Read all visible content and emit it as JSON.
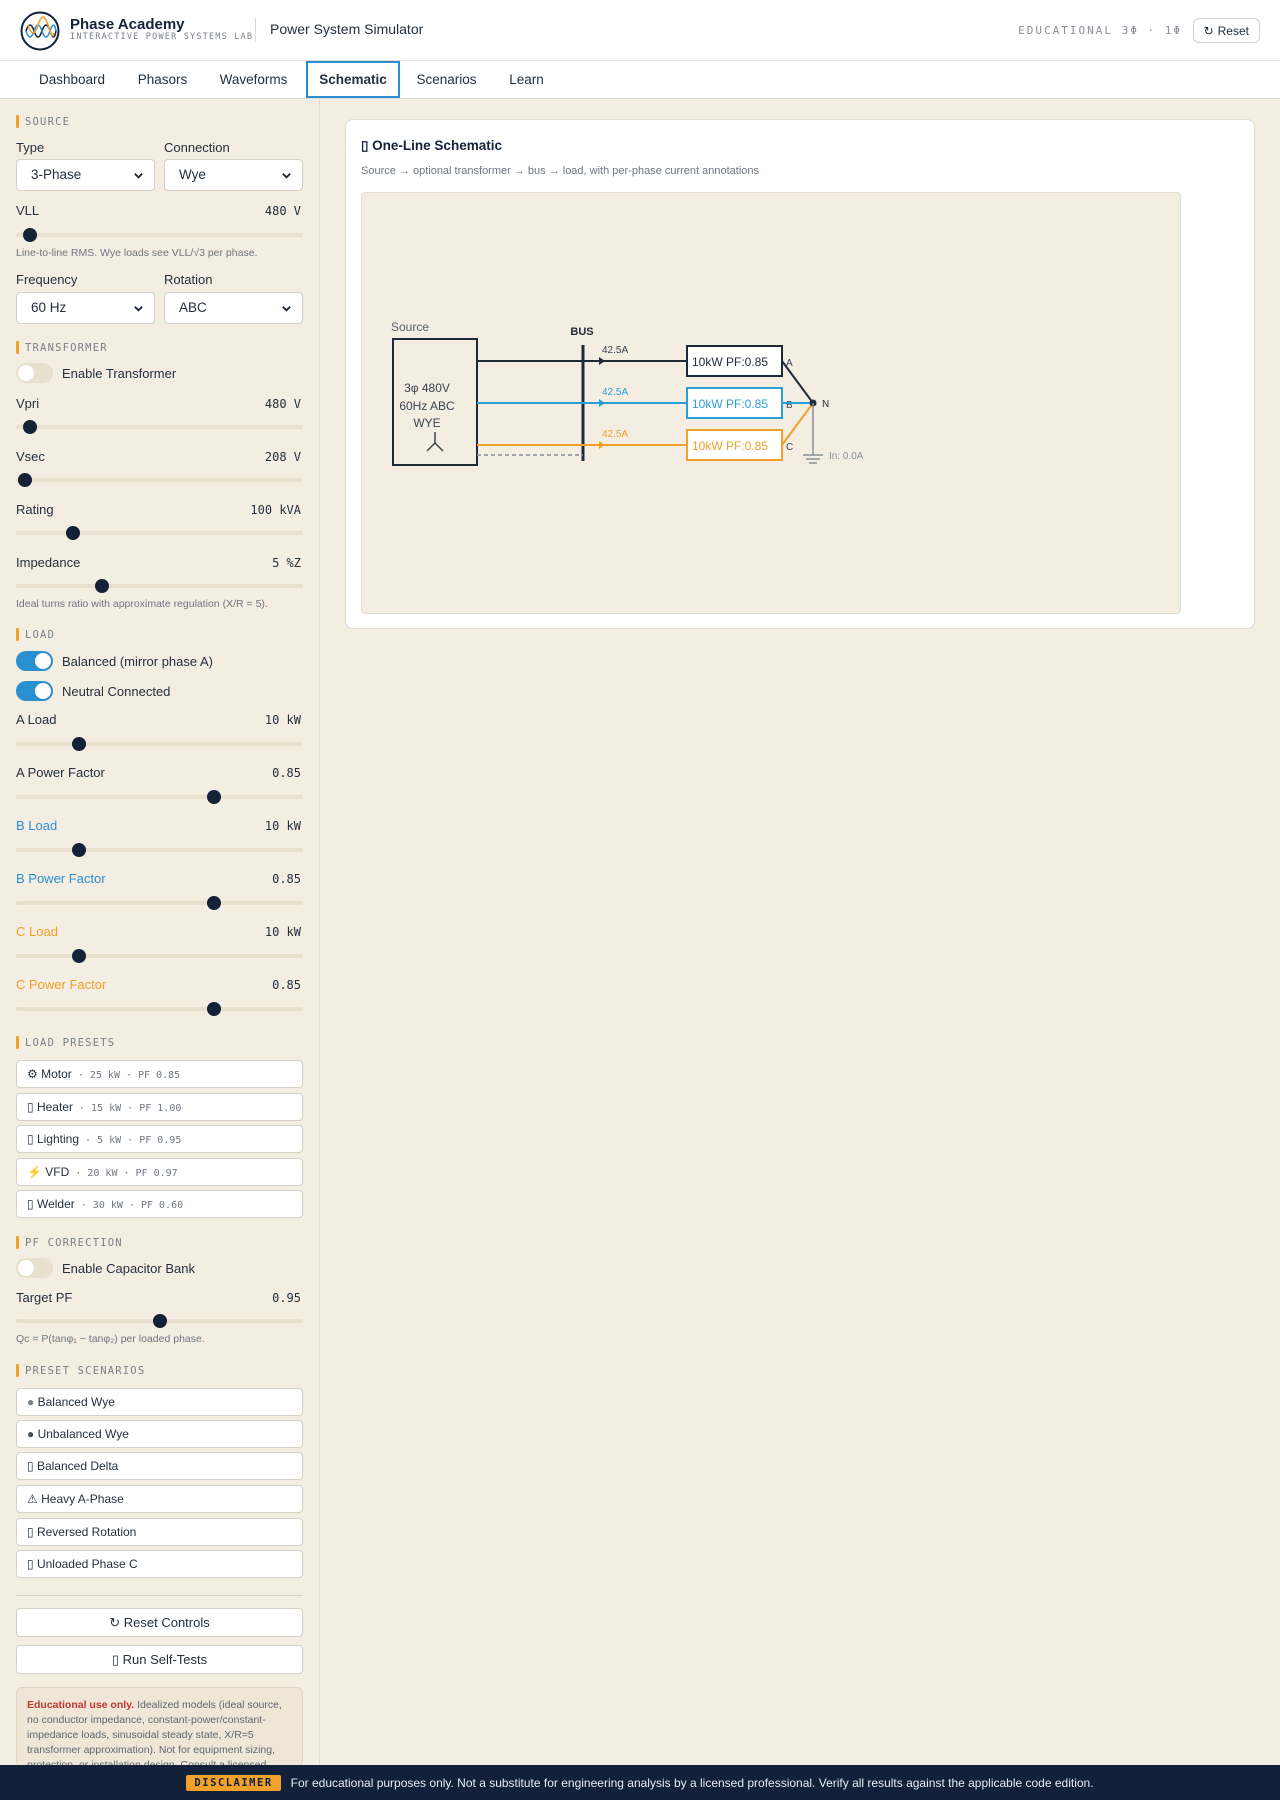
{
  "header": {
    "brand_name": "Phase Academy",
    "brand_sub": "INTERACTIVE POWER SYSTEMS LAB",
    "app_title": "Power System Simulator",
    "edu_badge": "EDUCATIONAL 3Φ · 1Φ",
    "reset_label": "Reset"
  },
  "tabs": [
    {
      "label": "Dashboard",
      "active": false
    },
    {
      "label": "Phasors",
      "active": false
    },
    {
      "label": "Waveforms",
      "active": false
    },
    {
      "label": "Schematic",
      "active": true
    },
    {
      "label": "Scenarios",
      "active": false
    },
    {
      "label": "Learn",
      "active": false
    }
  ],
  "sidebar": {
    "source": {
      "title": "SOURCE",
      "type_label": "Type",
      "type_value": "3-Phase",
      "connection_label": "Connection",
      "connection_value": "Wye",
      "vll_label": "VLL",
      "vll_value": "480 V",
      "vll_level": 0.05,
      "vll_hint": "Line-to-line RMS. Wye loads see VLL/√3 per phase.",
      "frequency_label": "Frequency",
      "frequency_value": "60 Hz",
      "rotation_label": "Rotation",
      "rotation_value": "ABC"
    },
    "transformer": {
      "title": "TRANSFORMER",
      "enable_label": "Enable Transformer",
      "enabled": false,
      "vpri_label": "Vpri",
      "vpri_value": "480 V",
      "vpri_level": 0.05,
      "vsec_label": "Vsec",
      "vsec_value": "208 V",
      "vsec_level": 0.03,
      "rating_label": "Rating",
      "rating_value": "100 kVA",
      "rating_level": 0.2,
      "impedance_label": "Impedance",
      "impedance_value": "5 %Z",
      "impedance_level": 0.3,
      "hint": "Ideal turns ratio with approximate regulation (X/R = 5)."
    },
    "load": {
      "title": "LOAD",
      "balanced_label": "Balanced (mirror phase A)",
      "balanced": true,
      "neutral_label": "Neutral Connected",
      "neutral": true,
      "phases": [
        {
          "load_label": "A Load",
          "load_value": "10 kW",
          "load_level": 0.22,
          "pf_label": "A Power Factor",
          "pf_value": "0.85",
          "pf_level": 0.69,
          "color": "#24303f"
        },
        {
          "load_label": "B Load",
          "load_value": "10 kW",
          "load_level": 0.22,
          "pf_label": "B Power Factor",
          "pf_value": "0.85",
          "pf_level": 0.69,
          "color": "#2a8fd0"
        },
        {
          "load_label": "C Load",
          "load_value": "10 kW",
          "load_level": 0.22,
          "pf_label": "C Power Factor",
          "pf_value": "0.85",
          "pf_level": 0.69,
          "color": "#f0a12a"
        }
      ]
    },
    "presets": {
      "title": "LOAD PRESETS",
      "items": [
        {
          "icon": "⚙",
          "name": "Motor",
          "meta": " · 25 kW · PF 0.85"
        },
        {
          "icon": "▯",
          "name": "Heater",
          "meta": " · 15 kW · PF 1.00"
        },
        {
          "icon": "▯",
          "name": "Lighting",
          "meta": " · 5 kW · PF 0.95"
        },
        {
          "icon": "⚡",
          "name": "VFD",
          "meta": " · 20 kW · PF 0.97"
        },
        {
          "icon": "▯",
          "name": "Welder",
          "meta": " · 30 kW · PF 0.60"
        }
      ]
    },
    "pf_correction": {
      "title": "PF CORRECTION",
      "enable_label": "Enable Capacitor Bank",
      "enabled": false,
      "target_label": "Target PF",
      "target_value": "0.95",
      "target_level": 0.5,
      "hint": "Qc = P(tanφ₁ − tanφ₂) per loaded phase."
    },
    "scenarios": {
      "title": "PRESET SCENARIOS",
      "items": [
        {
          "icon": "●",
          "label": "Balanced Wye"
        },
        {
          "icon": "●",
          "label": "Unbalanced Wye"
        },
        {
          "icon": "▯",
          "label": "Balanced Delta"
        },
        {
          "icon": "⚠",
          "label": "Heavy A-Phase"
        },
        {
          "icon": "▯",
          "label": "Reversed Rotation"
        },
        {
          "icon": "▯",
          "label": "Unloaded Phase C"
        }
      ]
    },
    "reset_controls_label": "↻ Reset Controls",
    "self_tests_label": "▯ Run Self-Tests",
    "disclaimer_strong": "Educational use only.",
    "disclaimer_text": " Idealized models (ideal source, no conductor impedance, constant-power/constant-impedance loads, sinusoidal steady state, X/R=5 transformer approximation). Not for equipment sizing, protection, or installation design. Consult a licensed"
  },
  "schematic": {
    "title": "▯ One-Line Schematic",
    "subtitle": "Source → optional transformer → bus → load, with per-phase current annotations",
    "source_label": "Source",
    "source_lines": [
      "3φ 480V",
      "60Hz ABC",
      "WYE"
    ],
    "bus_label": "BUS",
    "phases": [
      {
        "name": "A",
        "current": "42.5A",
        "load": "10kW PF:0.85",
        "color": "#1e2a3a"
      },
      {
        "name": "B",
        "current": "42.5A",
        "load": "10kW PF:0.85",
        "color": "#2a9fd6"
      },
      {
        "name": "C",
        "current": "42.5A",
        "load": "10kW PF:0.85",
        "color": "#f0a12a"
      }
    ],
    "neutral_label": "N",
    "neutral_current": "In: 0.0A"
  },
  "footer": {
    "tag": "DISCLAIMER",
    "text": "For educational purposes only. Not a substitute for engineering analysis by a licensed professional. Verify all results against the applicable code edition."
  }
}
